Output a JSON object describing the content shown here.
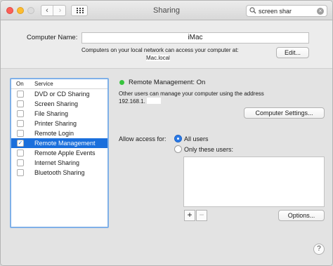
{
  "window": {
    "title": "Sharing"
  },
  "search": {
    "query": "screen shar"
  },
  "computer_name": {
    "label": "Computer Name:",
    "value": "iMac",
    "info_line": "Computers on your local network can access your computer at:",
    "address": "Mac.local",
    "edit_label": "Edit..."
  },
  "services": {
    "header_on": "On",
    "header_service": "Service",
    "items": [
      {
        "label": "DVD or CD Sharing",
        "checked": false
      },
      {
        "label": "Screen Sharing",
        "checked": false
      },
      {
        "label": "File Sharing",
        "checked": false
      },
      {
        "label": "Printer Sharing",
        "checked": false
      },
      {
        "label": "Remote Login",
        "checked": false
      },
      {
        "label": "Remote Management",
        "checked": true,
        "selected": true
      },
      {
        "label": "Remote Apple Events",
        "checked": false
      },
      {
        "label": "Internet Sharing",
        "checked": false
      },
      {
        "label": "Bluetooth Sharing",
        "checked": false
      }
    ]
  },
  "detail": {
    "status": "Remote Management: On",
    "status_color": "#38c43e",
    "description": "Other users can manage your computer using the address",
    "address": "192.168.1.",
    "computer_settings_label": "Computer Settings...",
    "allow_access_label": "Allow access for:",
    "option_all": "All users",
    "option_only": "Only these users:",
    "add_label": "+",
    "remove_label": "−",
    "options_label": "Options..."
  },
  "help_label": "?",
  "colors": {
    "accent": "#1a6fdc",
    "focus_ring": "#7fb0e8"
  }
}
